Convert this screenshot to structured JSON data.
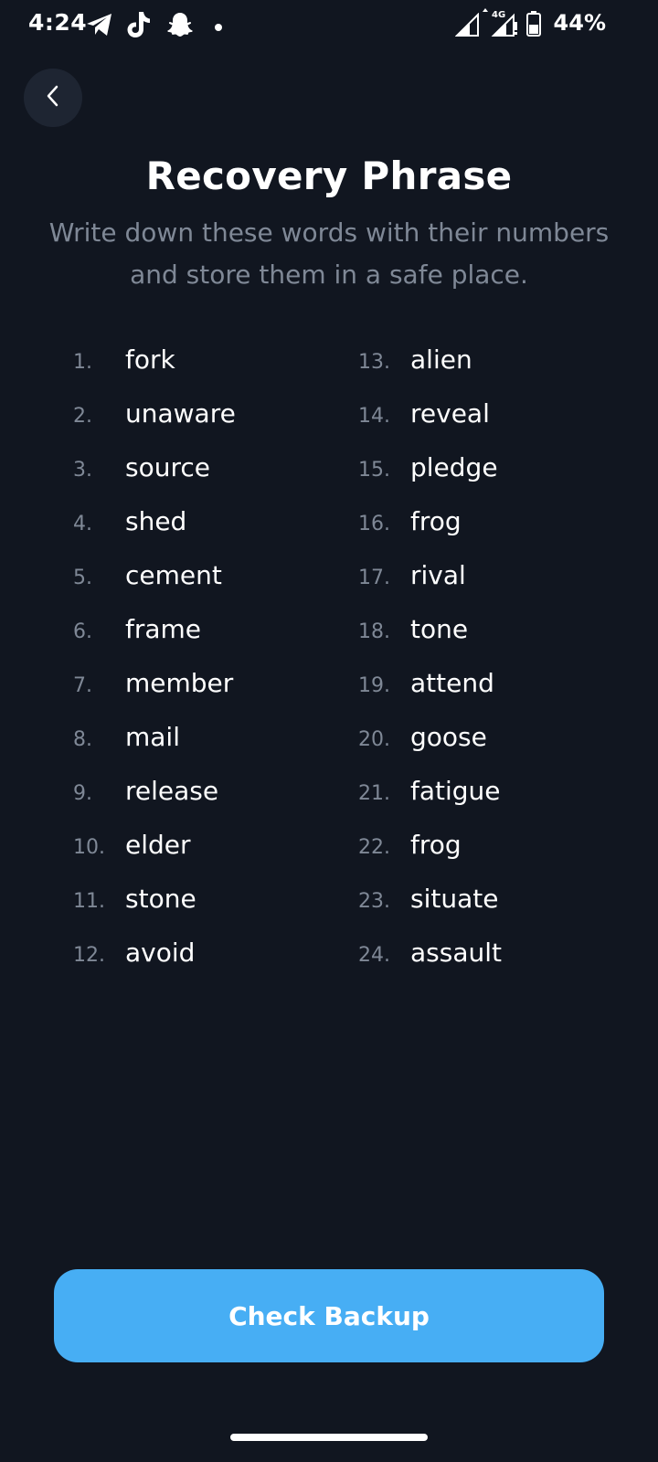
{
  "status_bar": {
    "time": "4:24",
    "left_icons": [
      "telegram-icon",
      "tiktok-icon",
      "snapchat-icon",
      "notification-dot-icon"
    ],
    "right_icons": [
      "signal-icon",
      "4g-signal-icon",
      "battery-icon"
    ],
    "battery": "44%"
  },
  "header": {
    "back_icon": "chevron-left-icon",
    "title": "Recovery Phrase",
    "subtitle": "Write down these words with their numbers and store them in a safe place."
  },
  "words": [
    {
      "num": "1.",
      "word": "fork"
    },
    {
      "num": "2.",
      "word": "unaware"
    },
    {
      "num": "3.",
      "word": "source"
    },
    {
      "num": "4.",
      "word": "shed"
    },
    {
      "num": "5.",
      "word": "cement"
    },
    {
      "num": "6.",
      "word": "frame"
    },
    {
      "num": "7.",
      "word": "member"
    },
    {
      "num": "8.",
      "word": "mail"
    },
    {
      "num": "9.",
      "word": "release"
    },
    {
      "num": "10.",
      "word": "elder"
    },
    {
      "num": "11.",
      "word": "stone"
    },
    {
      "num": "12.",
      "word": "avoid"
    },
    {
      "num": "13.",
      "word": "alien"
    },
    {
      "num": "14.",
      "word": "reveal"
    },
    {
      "num": "15.",
      "word": "pledge"
    },
    {
      "num": "16.",
      "word": "frog"
    },
    {
      "num": "17.",
      "word": "rival"
    },
    {
      "num": "18.",
      "word": "tone"
    },
    {
      "num": "19.",
      "word": "attend"
    },
    {
      "num": "20.",
      "word": "goose"
    },
    {
      "num": "21.",
      "word": "fatigue"
    },
    {
      "num": "22.",
      "word": "frog"
    },
    {
      "num": "23.",
      "word": "situate"
    },
    {
      "num": "24.",
      "word": "assault"
    }
  ],
  "actions": {
    "check_backup_label": "Check Backup"
  },
  "colors": {
    "background": "#111620",
    "accent": "#47aef4",
    "muted_text": "#7f8896",
    "back_button_bg": "#1e2532"
  }
}
